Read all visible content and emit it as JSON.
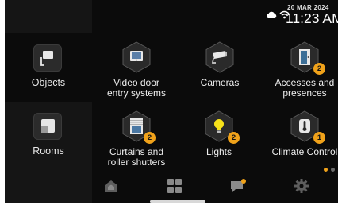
{
  "status": {
    "date": "20 MAR 2024",
    "time": "11:23 AM",
    "icons": [
      "cloud-icon",
      "wifi-icon"
    ]
  },
  "sidebar": {
    "items": [
      {
        "label": "Objects",
        "icon": "object-icon",
        "selected": true
      },
      {
        "label": "Rooms",
        "icon": "rooms-icon",
        "selected": false
      }
    ]
  },
  "tiles": [
    {
      "label_lines": [
        "Video door",
        "entry systems"
      ],
      "icon": "monitor-icon",
      "badge": ""
    },
    {
      "label_lines": [
        "Cameras"
      ],
      "icon": "camera-icon",
      "badge": ""
    },
    {
      "label_lines": [
        "Accesses and",
        "presences"
      ],
      "icon": "door-icon",
      "badge": "2"
    },
    {
      "label_lines": [
        "Curtains and",
        "roller shutters"
      ],
      "icon": "shutter-icon",
      "badge": "2"
    },
    {
      "label_lines": [
        "Lights"
      ],
      "icon": "bulb-icon",
      "badge": "2"
    },
    {
      "label_lines": [
        "Climate Control"
      ],
      "icon": "thermometer-icon",
      "badge": "1"
    }
  ],
  "pager": {
    "pages": 2,
    "current": 1
  },
  "bottom_nav": [
    {
      "icon": "home-icon",
      "notification": false
    },
    {
      "icon": "grid-icon",
      "notification": false
    },
    {
      "icon": "chat-icon",
      "notification": true
    },
    {
      "icon": "gear-icon",
      "notification": false
    }
  ],
  "colors": {
    "accent": "#f0a21a",
    "background": "#0b0b0b",
    "sidebar": "#151515",
    "tile": "#2b2b2b"
  }
}
